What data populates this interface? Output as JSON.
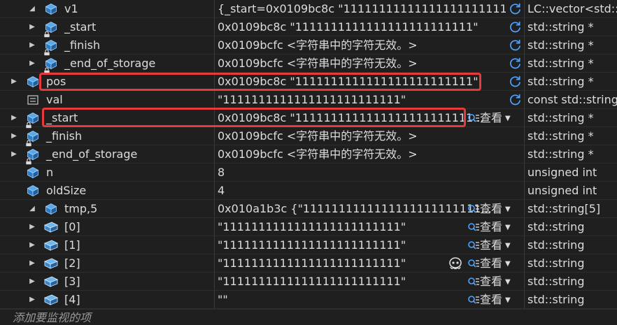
{
  "rows": [
    {
      "indent": 1,
      "arrow": "open",
      "icon": "field",
      "lock": false,
      "name": "v1",
      "value": "{_start=0x0109bc8c \"1111111111111111111111111...",
      "refresh": true,
      "viewer": false,
      "type": "LC::vector<std::st"
    },
    {
      "indent": 2,
      "arrow": "closed",
      "icon": "field",
      "lock": true,
      "name": "_start",
      "value": "0x0109bc8c \"1111111111111111111111111\"",
      "refresh": true,
      "viewer": false,
      "type": "std::string *"
    },
    {
      "indent": 2,
      "arrow": "closed",
      "icon": "field",
      "lock": true,
      "name": "_finish",
      "value": "0x0109bcfc  <字符串中的字符无效。>",
      "refresh": true,
      "viewer": false,
      "type": "std::string *"
    },
    {
      "indent": 2,
      "arrow": "closed",
      "icon": "field",
      "lock": true,
      "name": "_end_of_storage",
      "value": "0x0109bcfc  <字符串中的字符无效。>",
      "refresh": true,
      "viewer": false,
      "type": "std::string *"
    },
    {
      "indent": 0,
      "arrow": "closed",
      "icon": "field",
      "lock": false,
      "name": "pos",
      "value": "0x0109bc8c \"1111111111111111111111111\"",
      "refresh": true,
      "viewer": false,
      "type": "std::string *"
    },
    {
      "indent": 0,
      "arrow": "none",
      "icon": "local",
      "lock": false,
      "name": "val",
      "value": "\"1111111111111111111111111\"",
      "refresh": true,
      "viewer": false,
      "type": "const std::string..."
    },
    {
      "indent": 0,
      "arrow": "closed",
      "icon": "field",
      "lock": true,
      "name": "_start",
      "value": "0x0109bc8c \"1111111111111111111111111...",
      "refresh": false,
      "viewer": true,
      "type": "std::string *"
    },
    {
      "indent": 0,
      "arrow": "closed",
      "icon": "field",
      "lock": true,
      "name": "_finish",
      "value": "0x0109bcfc  <字符串中的字符无效。>",
      "refresh": false,
      "viewer": false,
      "type": "std::string *"
    },
    {
      "indent": 0,
      "arrow": "closed",
      "icon": "field",
      "lock": true,
      "name": "_end_of_storage",
      "value": "0x0109bcfc  <字符串中的字符无效。>",
      "refresh": false,
      "viewer": false,
      "type": "std::string *"
    },
    {
      "indent": 0,
      "arrow": "none",
      "icon": "field",
      "lock": false,
      "name": "n",
      "value": "8",
      "refresh": false,
      "viewer": false,
      "type": "unsigned int"
    },
    {
      "indent": 0,
      "arrow": "none",
      "icon": "field",
      "lock": false,
      "name": "oldSize",
      "value": "4",
      "refresh": false,
      "viewer": false,
      "type": "unsigned int"
    },
    {
      "indent": 1,
      "arrow": "open",
      "icon": "field",
      "lock": false,
      "name": "tmp,5",
      "value": "0x010a1b3c {\"1111111111111111111111111...",
      "refresh": false,
      "viewer": true,
      "type": "std::string[5]"
    },
    {
      "indent": 2,
      "arrow": "closed",
      "icon": "elem",
      "lock": false,
      "name": "[0]",
      "value": "\"1111111111111111111111111\"",
      "refresh": false,
      "viewer": true,
      "type": "std::string"
    },
    {
      "indent": 2,
      "arrow": "closed",
      "icon": "elem",
      "lock": false,
      "name": "[1]",
      "value": "\"1111111111111111111111111\"",
      "refresh": false,
      "viewer": true,
      "type": "std::string"
    },
    {
      "indent": 2,
      "arrow": "closed",
      "icon": "elem",
      "lock": false,
      "name": "[2]",
      "value": "\"1111111111111111111111111\"",
      "refresh": false,
      "viewer": true,
      "octo": true,
      "type": "std::string"
    },
    {
      "indent": 2,
      "arrow": "closed",
      "icon": "elem",
      "lock": false,
      "name": "[3]",
      "value": "\"1111111111111111111111111\"",
      "refresh": false,
      "viewer": true,
      "type": "std::string"
    },
    {
      "indent": 2,
      "arrow": "closed",
      "icon": "elem",
      "lock": false,
      "name": "[4]",
      "value": "\"\"",
      "refresh": false,
      "viewer": true,
      "type": "std::string"
    }
  ],
  "viewer_label": "查看",
  "add_watch_placeholder": "添加要监视的项",
  "colors": {
    "highlight": "#e8393d",
    "icon_blue": "#3d8fd6",
    "refresh_blue": "#4fa3ff"
  }
}
